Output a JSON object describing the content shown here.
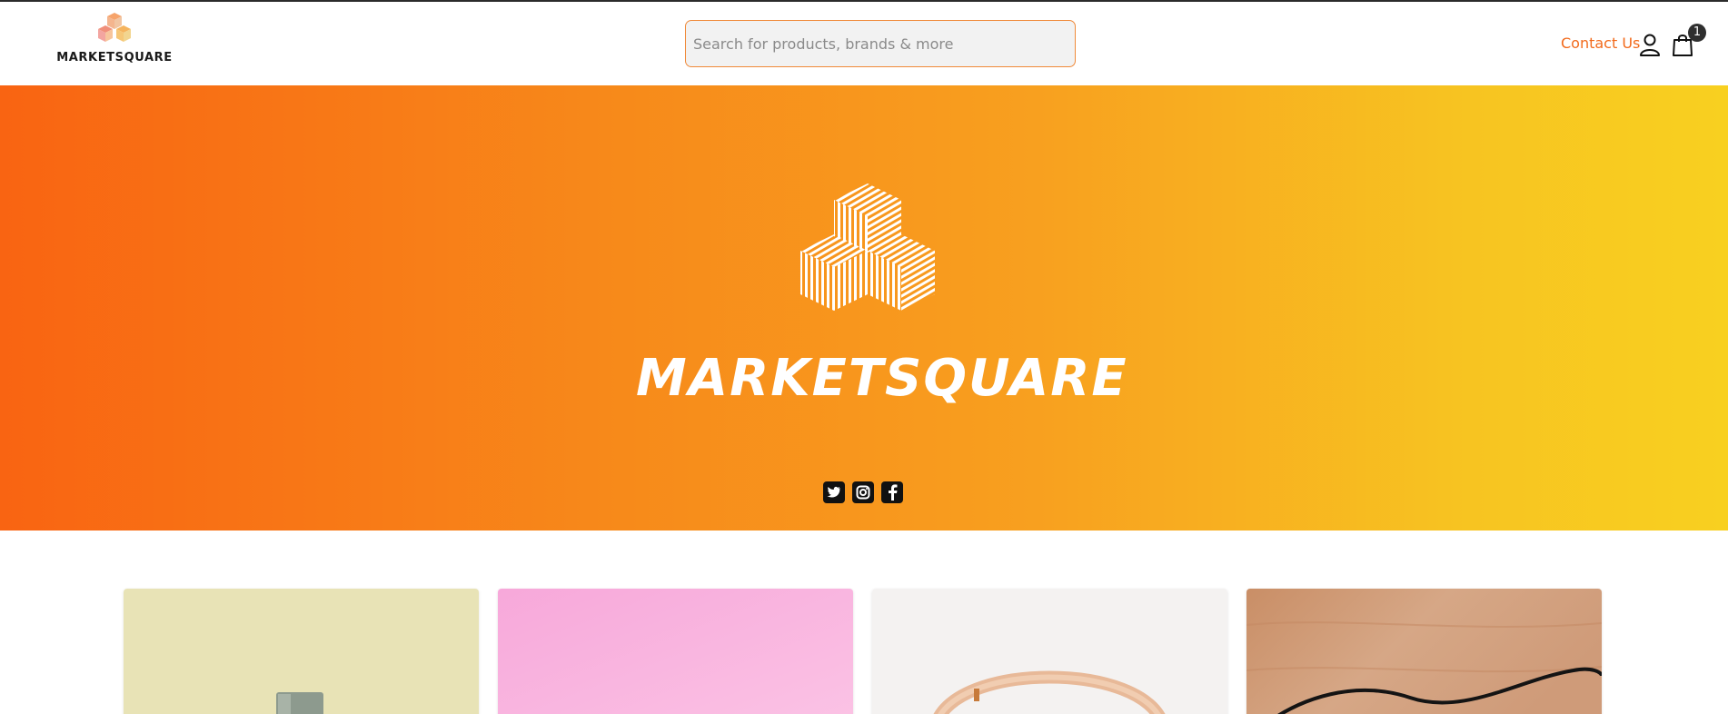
{
  "header": {
    "logo_text": "MARKETSQUARE",
    "search_placeholder": "Search for products, brands & more",
    "contact_label": "Contact Us",
    "user_icon": "user-icon",
    "cart_icon": "shopping-bag-icon",
    "cart_count": "1"
  },
  "hero": {
    "brand_text": "MARKETSQUARE",
    "socials": [
      {
        "name": "twitter-icon"
      },
      {
        "name": "instagram-icon"
      },
      {
        "name": "facebook-icon"
      }
    ]
  },
  "products": [
    {
      "name": "product-card-1",
      "color": "#e8e3b6"
    },
    {
      "name": "product-card-2",
      "color": "#f8b2dc"
    },
    {
      "name": "product-card-3",
      "color": "#f3f1f0"
    },
    {
      "name": "product-card-4",
      "color": "#cf9b79"
    }
  ],
  "colors": {
    "accent": "#f26a1b",
    "hero_start": "#f96412",
    "hero_end": "#f8d020"
  }
}
